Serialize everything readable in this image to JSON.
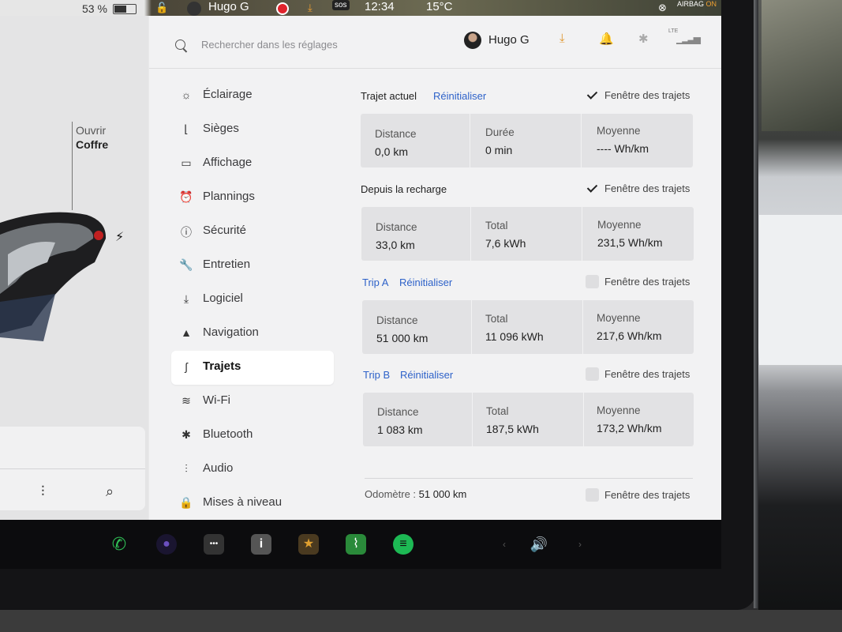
{
  "status_bar": {
    "battery": "53 %",
    "user": "Hugo G",
    "sos": "sos",
    "time": "12:34",
    "temperature": "15°C",
    "airbag_label": "AIRBAG",
    "airbag_state": "ON"
  },
  "car_pane": {
    "trunk_small": "Ouvrir",
    "trunk_big": "Coffre"
  },
  "header": {
    "search_placeholder": "Rechercher dans les réglages",
    "user_name": "Hugo G",
    "network_label": "LTE"
  },
  "nav": {
    "items": [
      {
        "label": "Éclairage",
        "icon": "sun-icon",
        "glyph": "☼"
      },
      {
        "label": "Sièges",
        "icon": "seat-icon",
        "glyph": "⌊"
      },
      {
        "label": "Affichage",
        "icon": "display-icon",
        "glyph": "▭"
      },
      {
        "label": "Plannings",
        "icon": "alarm-clock-icon",
        "glyph": "⏰"
      },
      {
        "label": "Sécurité",
        "icon": "info-circle-icon",
        "glyph": "ⓘ"
      },
      {
        "label": "Entretien",
        "icon": "wrench-icon",
        "glyph": "🔧"
      },
      {
        "label": "Logiciel",
        "icon": "download-icon",
        "glyph": "⤓"
      },
      {
        "label": "Navigation",
        "icon": "navigation-arrow-icon",
        "glyph": "▲"
      },
      {
        "label": "Trajets",
        "icon": "trips-icon",
        "glyph": "ʃ"
      },
      {
        "label": "Wi-Fi",
        "icon": "wifi-icon",
        "glyph": "≋"
      },
      {
        "label": "Bluetooth",
        "icon": "bluetooth-icon",
        "glyph": "✱"
      },
      {
        "label": "Audio",
        "icon": "equalizer-icon",
        "glyph": "⫶"
      },
      {
        "label": "Mises à niveau",
        "icon": "lock-icon",
        "glyph": "🔒"
      }
    ],
    "active": "Trajets"
  },
  "trips": {
    "current": {
      "title": "Trajet actuel",
      "reset": "Réinitialiser",
      "window_label": "Fenêtre des trajets",
      "window_checked": true,
      "col1_label": "Distance",
      "col1_value": "0,0 km",
      "col2_label": "Durée",
      "col2_value": "0 min",
      "col3_label": "Moyenne",
      "col3_value": "---- Wh/km"
    },
    "since_charge": {
      "title": "Depuis la recharge",
      "window_label": "Fenêtre des trajets",
      "window_checked": true,
      "col1_label": "Distance",
      "col1_value": "33,0 km",
      "col2_label": "Total",
      "col2_value": "7,6 kWh",
      "col3_label": "Moyenne",
      "col3_value": "231,5 Wh/km"
    },
    "trip_a": {
      "title": "Trip A",
      "reset": "Réinitialiser",
      "window_label": "Fenêtre des trajets",
      "window_checked": false,
      "col1_label": "Distance",
      "col1_value": "51 000 km",
      "col2_label": "Total",
      "col2_value": "11 096 kWh",
      "col3_label": "Moyenne",
      "col3_value": "217,6 Wh/km"
    },
    "trip_b": {
      "title": "Trip B",
      "reset": "Réinitialiser",
      "window_label": "Fenêtre des trajets",
      "window_checked": false,
      "col1_label": "Distance",
      "col1_value": "1 083 km",
      "col2_label": "Total",
      "col2_value": "187,5 kWh",
      "col3_label": "Moyenne",
      "col3_value": "173,2 Wh/km"
    },
    "odometer": {
      "label": "Odomètre :",
      "value": "51 000 km",
      "window_label": "Fenêtre des trajets",
      "window_checked": false
    }
  },
  "dock": {
    "items": [
      {
        "icon": "phone-icon",
        "glyph": "✆",
        "color": "#2fbf55"
      },
      {
        "icon": "camera-icon",
        "glyph": "●",
        "color": "#6b4fbf"
      },
      {
        "icon": "more-apps-icon",
        "glyph": "•••",
        "color": "#333333"
      },
      {
        "icon": "manual-icon",
        "glyph": "i",
        "color": "#555555"
      },
      {
        "icon": "toybox-icon",
        "glyph": "★",
        "color": "#e0a030"
      },
      {
        "icon": "energy-icon",
        "glyph": "⌇",
        "color": "#2a8a3a"
      },
      {
        "icon": "spotify-icon",
        "glyph": "≡",
        "color": "#1db954"
      }
    ],
    "volume_icon": "volume-icon"
  }
}
